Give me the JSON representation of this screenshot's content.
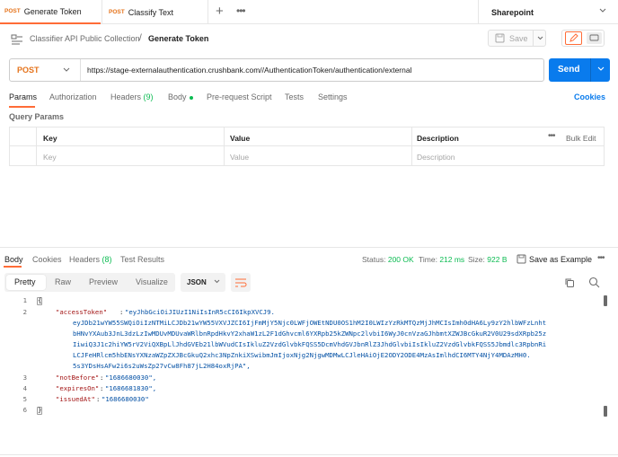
{
  "tabs": [
    {
      "method": "POST",
      "label": "Generate Token"
    },
    {
      "method": "POST",
      "label": "Classify Text"
    }
  ],
  "new_tab_symbol": "+",
  "more_symbol": "•••",
  "environment": "Sharepoint",
  "breadcrumb": {
    "collection": "Classifier API Public Collection",
    "separator": "/",
    "request": "Generate Token"
  },
  "save_label": "Save",
  "request": {
    "method": "POST",
    "url": "https://stage-externalauthentication.crushbank.com//AuthenticationToken/authentication/external",
    "send_label": "Send"
  },
  "request_tabs": {
    "params": "Params",
    "authorization": "Authorization",
    "headers": "Headers",
    "headers_count": "(9)",
    "body": "Body",
    "pre_request": "Pre-request Script",
    "tests": "Tests",
    "settings": "Settings",
    "cookies": "Cookies"
  },
  "query_params": {
    "title": "Query Params",
    "columns": [
      "Key",
      "Value",
      "Description"
    ],
    "placeholders": [
      "Key",
      "Value",
      "Description"
    ],
    "bulk_edit": "Bulk Edit"
  },
  "response_tabs": {
    "body": "Body",
    "cookies": "Cookies",
    "headers": "Headers",
    "headers_count": "(8)",
    "test_results": "Test Results"
  },
  "response_meta": {
    "status_label": "Status:",
    "status": "200 OK",
    "time_label": "Time:",
    "time": "212 ms",
    "size_label": "Size:",
    "size": "922 B",
    "save_example": "Save as Example"
  },
  "body_views": [
    "Pretty",
    "Raw",
    "Preview",
    "Visualize"
  ],
  "format": "JSON",
  "code": {
    "line_numbers": [
      "1",
      "2",
      "3",
      "4",
      "5",
      "6"
    ],
    "open_brace": "{",
    "close_brace": "}",
    "access_token_key": "\"accessToken\"",
    "access_token_lines": [
      "\"eyJhbGciOiJIUzI1NiIsInR5cCI6IkpXVCJ9.",
      "eyJDb21wYW55SWQiOiIzNTMiLCJDb21wYW55VXVJZCI6IjFmMjY5Njc0LWFjOWEtNDU0OS1hM2I0LWIzYzRkMTQzMjJhMCIsImh0dHA6Ly9zY2hlbWFzLnht",
      "bHNvYXAub3JnL3dzLzIwMDUvMDUvaWRlbnRpdHkvY2xhaW1zL2F1dGhvcml6YXRpb25kZWNpc2lvbiI6WyJ0cnVzaGJhbmtXZWJBcGkuR2V0U29sdXRpb25z",
      "IiwiQ3J1c2hiYW5rV2ViQXBpLlJhdGVEb21lbWVudCIsIkluZ2VzdGlvbkFQSS5DcmVhdGVJbnRlZ3JhdGlvbiIsIkluZ2VzdGlvbkFQSS5Jbmdlc3RpbnRi",
      "LCJFeHRlcm5hbENsYXNzaWZpZXJBcGkuQ2xhc3NpZnkiXSwibmJmIjoxNjg2NjgwMDMwLCJleHAiOjE2ODY2ODE4MzAsImlhdCI6MTY4NjY4MDAzMH0.",
      "5s3YDsHsAFw2i6s2uWsZp27vCw8Fh87jL2H84oxRjPA\","
    ],
    "not_before_key": "\"notBefore\"",
    "not_before_val": "\"1686680030\",",
    "expires_on_key": "\"expiresOn\"",
    "expires_on_val": "\"1686681830\",",
    "issued_at_key": "\"issuedAt\"",
    "issued_at_val": "\"1686680030\""
  },
  "colors": {
    "accent": "#ff6c37",
    "method": "#e5731b",
    "send": "#097bed",
    "success": "#0cbb52"
  }
}
